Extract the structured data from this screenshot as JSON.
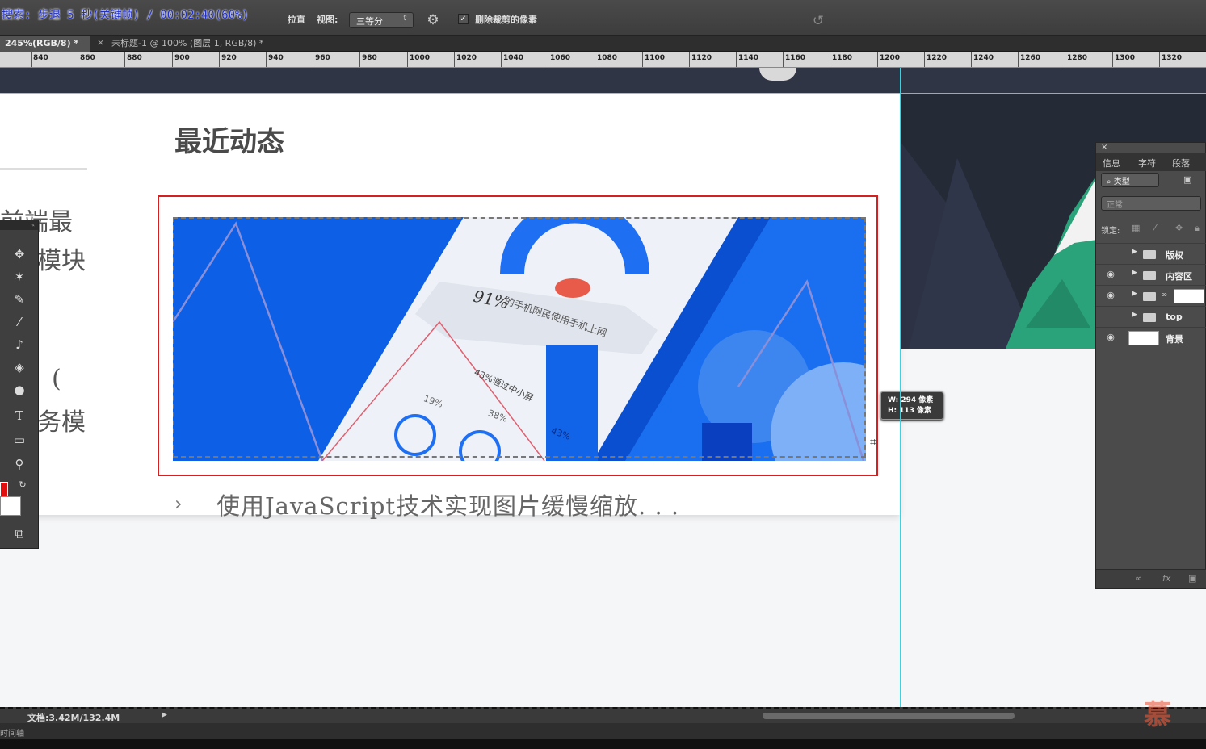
{
  "overlay": {
    "search_text": "搜索: 步退 5 秒(关键帧) / 00:02:40(60%)"
  },
  "options_bar": {
    "straighten_label": "拉直",
    "view_label": "视图:",
    "view_value": "三等分",
    "delete_cropped_label": "删除裁剪的像素",
    "delete_cropped_checked": true
  },
  "tabs": [
    {
      "label": "245%(RGB/8) *"
    },
    {
      "label": "未标题-1 @ 100% (图层 1, RGB/8) *"
    }
  ],
  "ruler": {
    "labels": [
      "840",
      "860",
      "880",
      "900",
      "920",
      "940",
      "960",
      "980",
      "1000",
      "1020",
      "1040",
      "1060",
      "1080",
      "1100",
      "1120",
      "1140",
      "1160",
      "1180",
      "1200",
      "1220",
      "1240",
      "1260",
      "1280",
      "1300",
      "1320"
    ]
  },
  "canvas": {
    "section_title": "最近动态",
    "left_fragments": [
      "前端最",
      "模块",
      "(",
      "务模"
    ],
    "article_text": "使用JavaScript技术实现图片缓慢缩放. . .",
    "banner": {
      "percent": "91%",
      "caption": "的手机网民使用手机上网",
      "sub": "43%通过中小屏",
      "labels": [
        "19%",
        "38%",
        "43%"
      ]
    },
    "crop_tooltip": {
      "w": "W: 294 像素",
      "h": "H: 113 像素"
    }
  },
  "layers_panel": {
    "tabs": [
      "信息",
      "字符",
      "段落"
    ],
    "filter": "类型",
    "blend_mode": "正常",
    "lock_label": "锁定:",
    "layers": [
      {
        "name": "版权",
        "type": "group",
        "visible": false
      },
      {
        "name": "内容区",
        "type": "group",
        "visible": true
      },
      {
        "name": "",
        "type": "group-mask",
        "visible": true
      },
      {
        "name": "top",
        "type": "group",
        "visible": false
      },
      {
        "name": "背景",
        "type": "layer",
        "visible": true
      }
    ]
  },
  "status": {
    "doc": "文档:3.42M/132.4M",
    "timeline": "时间轴"
  },
  "watermark": "慕"
}
